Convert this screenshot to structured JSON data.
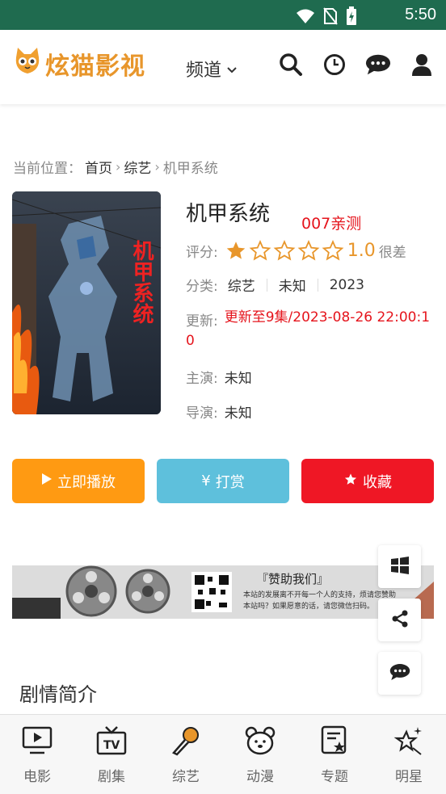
{
  "status": {
    "time": "5:50"
  },
  "header": {
    "logo_text": "炫猫影视",
    "channel_label": "频道"
  },
  "breadcrumb": {
    "prefix": "当前位置：",
    "items": [
      "首页",
      "综艺",
      "机甲系统"
    ],
    "separator": "›"
  },
  "detail": {
    "title": "机甲系统",
    "tag": "007亲测",
    "rating": {
      "label": "评分:",
      "score": "1.0",
      "text": "很差",
      "stars_filled": 1,
      "stars_total": 5
    },
    "category": {
      "label": "分类:",
      "values": [
        "综艺",
        "未知",
        "2023"
      ]
    },
    "update": {
      "label": "更新:",
      "line1": "更新至9集/2023-08-26 22:00:1",
      "line2": "0"
    },
    "cast": {
      "label": "主演:",
      "value": "未知"
    },
    "director": {
      "label": "导演:",
      "value": "未知"
    },
    "poster_text": "机甲系统"
  },
  "actions": {
    "play": "立即播放",
    "reward": "打赏",
    "favorite": "收藏"
  },
  "banner": {
    "title": "『赞助我们』",
    "text_line1": "本站的发展离不开每一个人的支持，烦请您赞助",
    "text_line2": "本站吗？如果愿意的话，请您微信扫码。"
  },
  "section": {
    "synopsis_title": "剧情简介"
  },
  "bottom_nav": [
    {
      "label": "电影",
      "icon": "tv-play-icon"
    },
    {
      "label": "剧集",
      "icon": "tv-icon"
    },
    {
      "label": "综艺",
      "icon": "microphone-icon"
    },
    {
      "label": "动漫",
      "icon": "bear-icon"
    },
    {
      "label": "专题",
      "icon": "topic-star-icon"
    },
    {
      "label": "明星",
      "icon": "sparkle-star-icon"
    }
  ],
  "colors": {
    "status_bar": "#1f6b4f",
    "accent_orange": "#ff9a12",
    "accent_blue": "#5ec0dc",
    "accent_red": "#ef1725",
    "rating_color": "#e8962b"
  }
}
